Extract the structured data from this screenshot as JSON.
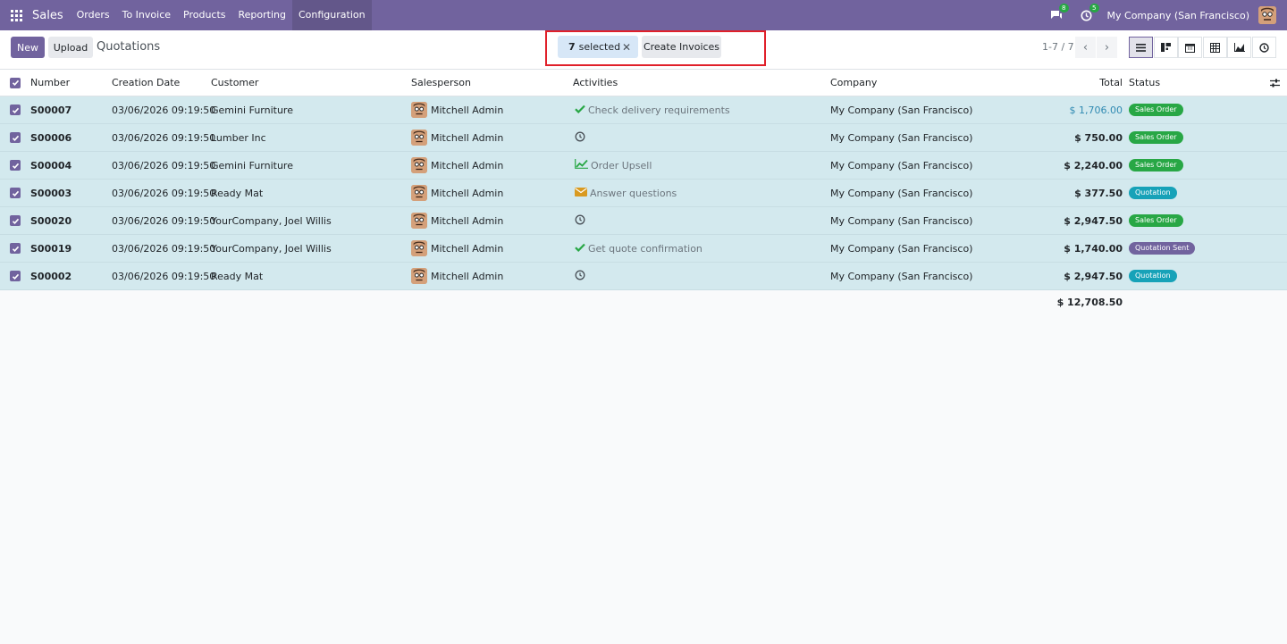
{
  "navbar": {
    "brand": "Sales",
    "menu": [
      {
        "label": "Orders"
      },
      {
        "label": "To Invoice"
      },
      {
        "label": "Products"
      },
      {
        "label": "Reporting"
      },
      {
        "label": "Configuration"
      }
    ],
    "messages_count": "8",
    "activities_count": "5",
    "company": "My Company (San Francisco)",
    "colors": {
      "bar": "#71639e"
    }
  },
  "control": {
    "new_label": "New",
    "upload_label": "Upload",
    "title": "Quotations",
    "selected_count": "7",
    "selected_label": "selected",
    "create_invoices_label": "Create Invoices",
    "pager": "1-7 / 7",
    "views": [
      "list-icon",
      "kanban-icon",
      "calendar-icon",
      "pivot-icon",
      "graph-icon",
      "activity-icon"
    ]
  },
  "table": {
    "headers": {
      "number": "Number",
      "date": "Creation Date",
      "customer": "Customer",
      "salesperson": "Salesperson",
      "activities": "Activities",
      "company": "Company",
      "total": "Total",
      "status": "Status"
    },
    "rows": [
      {
        "number": "S00007",
        "date": "03/06/2026 09:19:50",
        "customer": "Gemini Furniture",
        "salesperson": "Mitchell Admin",
        "activity_icon": "check-icon",
        "activity": "Check delivery requirements",
        "company": "My Company (San Francisco)",
        "total": "$ 1,706.00",
        "status": "Sales Order"
      },
      {
        "number": "S00006",
        "date": "03/06/2026 09:19:50",
        "customer": "Lumber Inc",
        "salesperson": "Mitchell Admin",
        "activity_icon": "clock-icon",
        "activity": "",
        "company": "My Company (San Francisco)",
        "total": "$ 750.00",
        "status": "Sales Order"
      },
      {
        "number": "S00004",
        "date": "03/06/2026 09:19:50",
        "customer": "Gemini Furniture",
        "salesperson": "Mitchell Admin",
        "activity_icon": "chart-icon",
        "activity": "Order Upsell",
        "company": "My Company (San Francisco)",
        "total": "$ 2,240.00",
        "status": "Sales Order"
      },
      {
        "number": "S00003",
        "date": "03/06/2026 09:19:50",
        "customer": "Ready Mat",
        "salesperson": "Mitchell Admin",
        "activity_icon": "envelope-icon",
        "activity": "Answer questions",
        "company": "My Company (San Francisco)",
        "total": "$ 377.50",
        "status": "Quotation"
      },
      {
        "number": "S00020",
        "date": "03/06/2026 09:19:50",
        "customer": "YourCompany, Joel Willis",
        "salesperson": "Mitchell Admin",
        "activity_icon": "clock-icon",
        "activity": "",
        "company": "My Company (San Francisco)",
        "total": "$ 2,947.50",
        "status": "Sales Order"
      },
      {
        "number": "S00019",
        "date": "03/06/2026 09:19:50",
        "customer": "YourCompany, Joel Willis",
        "salesperson": "Mitchell Admin",
        "activity_icon": "check-icon",
        "activity": "Get quote confirmation",
        "company": "My Company (San Francisco)",
        "total": "$ 1,740.00",
        "status": "Quotation Sent"
      },
      {
        "number": "S00002",
        "date": "03/06/2026 09:19:50",
        "customer": "Ready Mat",
        "salesperson": "Mitchell Admin",
        "activity_icon": "clock-icon",
        "activity": "",
        "company": "My Company (San Francisco)",
        "total": "$ 2,947.50",
        "status": "Quotation"
      }
    ],
    "sum_total": "$ 12,708.50"
  },
  "status_colors": {
    "Sales Order": "#28a745",
    "Quotation": "#17a2b8",
    "Quotation Sent": "#71639e"
  }
}
